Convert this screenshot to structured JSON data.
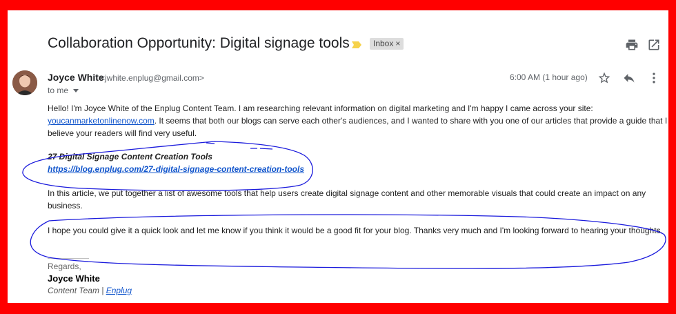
{
  "email": {
    "subject": "Collaboration Opportunity: Digital signage tools",
    "label": "Inbox",
    "label_close": "×",
    "sender_name": "Joyce White",
    "sender_email": "<jwhite.enplug@gmail.com>",
    "to_line": "to me",
    "timestamp": "6:00 AM (1 hour ago)",
    "para1_a": "Hello! I'm Joyce White of the Enplug Content Team. I am researching relevant information on digital marketing and I'm happy I came across your site:",
    "para1_link": "youcanmarketonlinenow.com",
    "para1_b": ". It seems that both our blogs can serve each other's audiences, and I wanted to share with you one of our articles that provide a guide that I believe your readers will find very useful.",
    "article_title": "27 Digital Signage Content Creation Tools",
    "article_link": "https://blog.enplug.com/27-digital-signage-content-creation-tools",
    "para2": "In this article, we put together a list of awesome tools that help users create digital signage content and other memorable visuals that could create an impact on any business.",
    "para3": "I hope you could give it a quick look and let me know if you think it would be a good fit for your blog. Thanks very much and I'm looking forward to hearing your thoughts.",
    "regards": "Regards,",
    "sig_name": "Joyce White",
    "sig_team": "Content Team | ",
    "sig_link": "Enplug"
  },
  "icons": {
    "print": "print-icon",
    "open_new": "open-in-new-window-icon",
    "star": "star-icon",
    "reply": "reply-icon",
    "more": "more-vertical-icon",
    "importance": "importance-marker-icon",
    "dropdown": "chevron-down-icon"
  },
  "colors": {
    "frame_border": "#ff0000",
    "annotation": "#1a1adc",
    "link": "#1155cc",
    "importance": "#f6d24a"
  }
}
